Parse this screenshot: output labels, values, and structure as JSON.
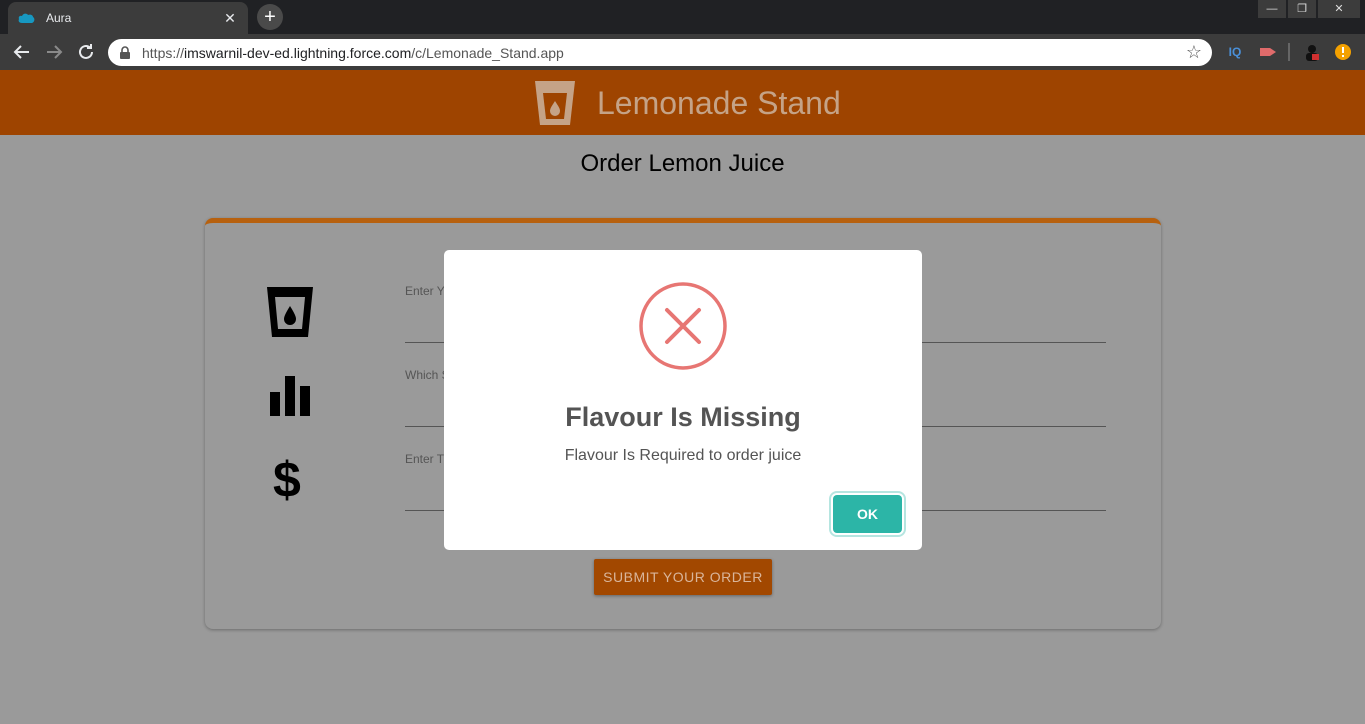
{
  "browser": {
    "tab_title": "Aura",
    "tab_close": "✕",
    "new_tab": "+",
    "url_prefix": "https://",
    "url_host": "imswarnil-dev-ed.lightning.force.com",
    "url_path": "/c/Lemonade_Stand.app",
    "extensions": [
      "IQ"
    ],
    "window_controls": [
      "—",
      "❐",
      "✕"
    ]
  },
  "app": {
    "title": "Lemonade Stand",
    "brand_color": "#9e4400"
  },
  "page": {
    "title": "Order Lemon Juice",
    "fields": [
      {
        "label": "Enter Y",
        "icon": "cup-icon"
      },
      {
        "label": "Which S",
        "icon": "bar-chart-icon"
      },
      {
        "label": "Enter T",
        "icon": "dollar-icon"
      }
    ],
    "submit_label": "SUBMIT YOUR ORDER"
  },
  "modal": {
    "title": "Flavour Is Missing",
    "text": "Flavour Is Required to order juice",
    "ok_label": "OK",
    "icon": "error-x-icon",
    "accent_color": "#2cb5a7",
    "error_color": "#e77673"
  }
}
